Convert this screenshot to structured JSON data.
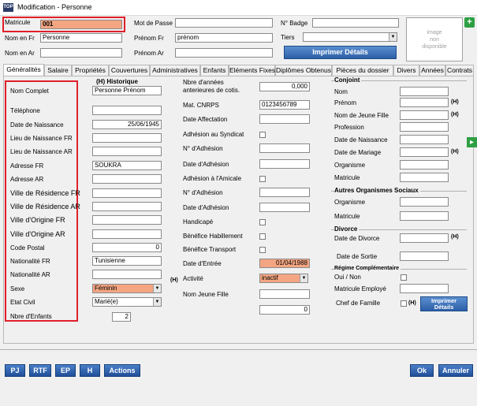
{
  "window": {
    "title": "Modification - Personne",
    "app_icon": "TOP"
  },
  "header": {
    "matricule_label": "Matricule",
    "matricule_value": "001",
    "nom_fr_label": "Nom en Fr",
    "nom_fr_value": "Personne",
    "nom_ar_label": "Nom en Ar",
    "nom_ar_value": "",
    "mot_de_passe_label": "Mot de Passe",
    "mot_de_passe_value": "",
    "prenom_fr_label": "Prénom Fr",
    "prenom_fr_value": "prénom",
    "prenom_ar_label": "Prénom Ar",
    "prenom_ar_value": "",
    "badge_label": "N° Badge",
    "badge_value": "",
    "tiers_label": "Tiers",
    "tiers_value": "",
    "print_details_label": "Imprimer Détails",
    "photo_placeholder": "image\nnon\ndisponible"
  },
  "tabs": [
    "Généralités",
    "Salaire",
    "Propriétés",
    "Couvertures",
    "Administratives",
    "Enfants",
    "Eléments Fixes",
    "Diplômes Obtenus",
    "Pièces du dossier",
    "Divers",
    "Années",
    "Contrats"
  ],
  "col1": {
    "historique_label": "(H) Historique",
    "nom_complet_label": "Nom Complet",
    "nom_complet_value": "Personne Prénom",
    "telephone_label": "Téléphone",
    "telephone_value": "",
    "date_naissance_label": "Date de Naissance",
    "date_naissance_value": "25/06/1945",
    "lieu_naissance_fr_label": "Lieu de Naissance FR",
    "lieu_naissance_fr_value": "",
    "lieu_naissance_ar_label": "Lieu de Naissance AR",
    "lieu_naissance_ar_value": "",
    "adresse_fr_label": "Adresse FR",
    "adresse_fr_value": "SOUKRA",
    "adresse_ar_label": "Adresse AR",
    "adresse_ar_value": "",
    "ville_res_fr_label": "Ville de Résidence FR",
    "ville_res_ar_label": "Ville de Résidence AR",
    "ville_orig_fr_label": "Ville d'Origine FR",
    "ville_orig_ar_label": "Ville d'Origine AR",
    "code_postal_label": "Code Postal",
    "code_postal_value": "0",
    "nationalite_fr_label": "Nationalité FR",
    "nationalite_fr_value": "Tunisienne",
    "nationalite_ar_label": "Nationalité AR",
    "nationalite_ar_value": "",
    "sexe_label": "Sexe",
    "sexe_value": "Féminin",
    "etat_civil_label": "Etat Civil",
    "etat_civil_value": "Marié(e)",
    "nbre_enfants_label": "Nbre d'Enfants",
    "nbre_enfants_value": "2",
    "h_mark": "(H)"
  },
  "col2": {
    "annees_ant_label": "Nbre d'années anterieures de cotis.",
    "annees_ant_value": "0,000",
    "cnrps_label": "Mat. CNRPS",
    "cnrps_value": "0123456789",
    "date_affectation_label": "Date Affectation",
    "adhesion_syndicat_label": "Adhésion au Syndicat",
    "num_adhesion_1_label": "N° d'Adhésion",
    "date_adhesion_1_label": "Date d'Adhésion",
    "adhesion_amicale_label": "Adhésion à l'Amicale",
    "num_adhesion_2_label": "N° d'Adhésion",
    "date_adhesion_2_label": "Date d'Adhésion",
    "handicape_label": "Handicapé",
    "benef_habillement_label": "Bénéfice Habillement",
    "benef_transport_label": "Bénéfice Transport",
    "date_entree_label": "Date d'Entrée",
    "date_entree_value": "01/04/1988",
    "activite_label": "Activité",
    "activite_value": "inactif",
    "nom_jeune_fille_label": "Nom Jeune Fille",
    "extra_value": "0"
  },
  "col3": {
    "conjoint_title": "Conjoint",
    "nom_label": "Nom",
    "prenom_label": "Prénom",
    "nom_jeune_fille_label": "Nom de Jeune Fille",
    "profession_label": "Profession",
    "date_naissance_label": "Date de Naissance",
    "date_mariage_label": "Date de Mariage",
    "organisme_label": "Organisme",
    "matricule_label": "Matricule",
    "autres_title": "Autres Organismes Sociaux",
    "autres_organisme_label": "Organisme",
    "autres_matricule_label": "Matricule",
    "divorce_title": "Divorce",
    "date_divorce_label": "Date de Divorce",
    "date_sortie_label": "Date de Sortie",
    "regime_title": "Régime Complémentaire",
    "oui_non_label": "Oui / Non",
    "matricule_employe_label": "Matricule Employé",
    "chef_famille_label": "Chef de Famille",
    "h_mark": "(H)",
    "imprimer_details_label": "Imprimer Détails"
  },
  "bottom": {
    "pj_label": "PJ",
    "rtf_label": "RTF",
    "ep_label": "EP",
    "h_label": "H",
    "actions_label": "Actions",
    "ok_label": "Ok",
    "annuler_label": "Annuler"
  },
  "colors": {
    "orange_field": "#f4a582",
    "red_highlight": "#e0202a",
    "blue_button": "#2c5fa6"
  }
}
